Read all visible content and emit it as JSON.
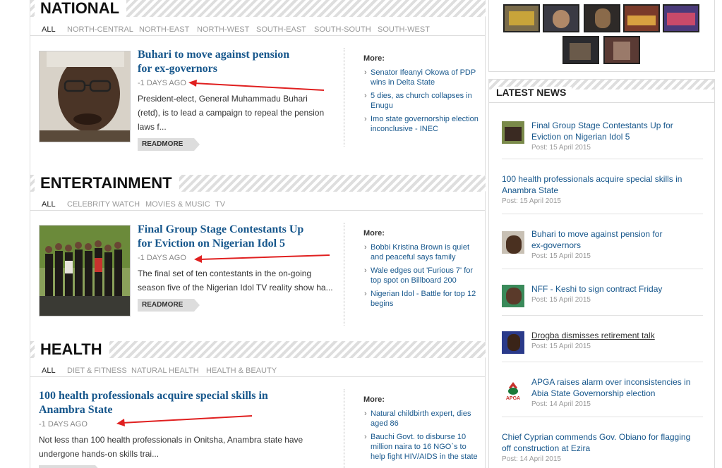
{
  "national": {
    "title": "NATIONAL",
    "tabs": [
      "ALL",
      "NORTH-CENTRAL",
      "NORTH-EAST",
      "NORTH-WEST",
      "SOUTH-EAST",
      "SOUTH-SOUTH",
      "SOUTH-WEST"
    ],
    "headline": [
      "Buhari to move against pension",
      "for ex-governors"
    ],
    "date": "-1 DAYS AGO",
    "excerpt": [
      "President-elect, General Muhammadu Buhari",
      "(retd), is to lead a campaign to repeal the pension",
      "laws f..."
    ],
    "readmore": "READMORE",
    "more_label": "More:",
    "more": [
      [
        "Senator Ifeanyi Okowa of PDP",
        "wins in Delta State"
      ],
      [
        "5 dies, as church collapses in",
        "Enugu"
      ],
      [
        "Imo state governorship election",
        "inconclusive - INEC"
      ]
    ]
  },
  "entertainment": {
    "title": "ENTERTAINMENT",
    "tabs": [
      "ALL",
      "CELEBRITY WATCH",
      "MOVIES & MUSIC",
      "TV"
    ],
    "headline": [
      "Final Group Stage Contestants Up",
      "for Eviction on Nigerian Idol 5"
    ],
    "date": "-1 DAYS AGO",
    "excerpt": [
      "The final set of ten contestants in the on-going",
      "season five of the Nigerian Idol TV reality show ha..."
    ],
    "readmore": "READMORE",
    "more_label": "More:",
    "more": [
      [
        "Bobbi Kristina Brown is quiet",
        "and peaceful says family"
      ],
      [
        "Wale edges out 'Furious 7' for",
        "top spot on Billboard 200"
      ],
      [
        "Nigerian Idol - Battle for top 12",
        "begins"
      ]
    ]
  },
  "health": {
    "title": "HEALTH",
    "tabs": [
      "ALL",
      "DIET & FITNESS",
      "NATURAL HEALTH",
      "HEALTH & BEAUTY"
    ],
    "headline": [
      "100 health professionals acquire special skills in",
      "Anambra State"
    ],
    "date": "-1 DAYS AGO",
    "excerpt": [
      "Not less than 100 health professionals in Onitsha, Anambra state have",
      "undergone hands-on skills trai..."
    ],
    "more_label": "More:",
    "more": [
      [
        "Natural childbirth expert, dies",
        "aged 86"
      ],
      [
        "Bauchi Govt. to disburse 10",
        "million naira to 16 NGO`s to",
        "help fight HIV/AIDS in the state"
      ]
    ]
  },
  "latest": {
    "title": "LATEST NEWS",
    "items": [
      {
        "title": [
          "Final Group Stage Contestants Up for",
          "Eviction on Nigerian Idol 5"
        ],
        "date": "Post: 15 April 2015"
      },
      {
        "title": [
          "100 health professionals acquire special skills in",
          "Anambra State"
        ],
        "date": "Post: 15 April 2015"
      },
      {
        "title": [
          "Buhari to move against pension for",
          "ex-governors"
        ],
        "date": "Post: 15 April 2015"
      },
      {
        "title": [
          "NFF - Keshi to sign contract Friday"
        ],
        "date": "Post: 15 April 2015"
      },
      {
        "title": [
          "Drogba dismisses retirement talk"
        ],
        "date": "Post: 15 April 2015"
      },
      {
        "title": [
          "APGA raises alarm over inconsistencies in",
          "Abia State Governorship election"
        ],
        "date": "Post: 14 April 2015"
      },
      {
        "title": [
          "Chief Cyprian commends Gov. Obiano for flagging",
          "off construction at Ezira"
        ],
        "date": "Post: 14 April 2015"
      }
    ]
  },
  "apga_logo_text": "APGA",
  "colors": {
    "link": "#17578c",
    "annotation_arrow": "#e02020"
  }
}
